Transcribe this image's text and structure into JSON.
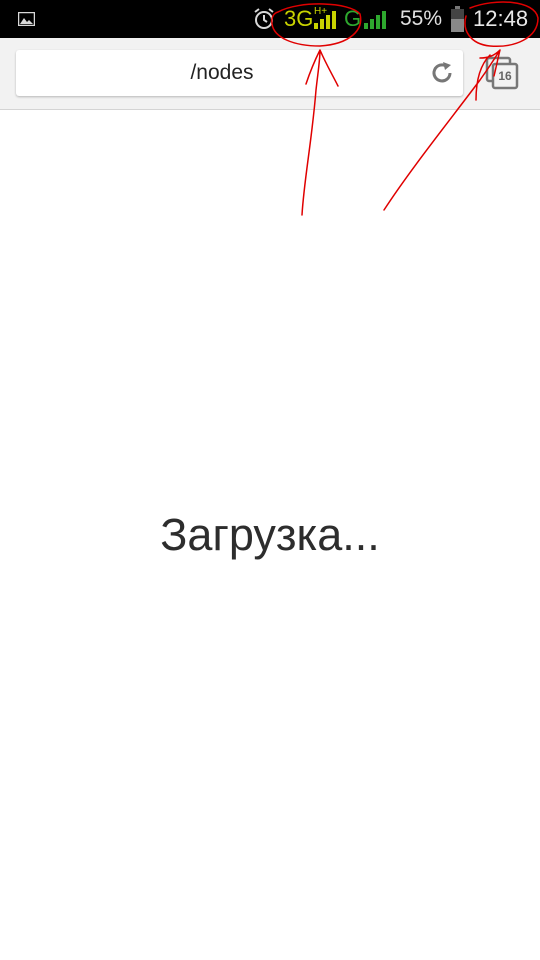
{
  "status_bar": {
    "network_type": "3G",
    "network_sub": "H+",
    "second_network": "G",
    "battery_percent": "55%",
    "time": "12:48",
    "icons": [
      "gallery-icon",
      "alarm-icon",
      "signal-icon",
      "battery-icon"
    ],
    "colors": {
      "network": "#c9d300",
      "signal_secondary": "#2ea82e"
    }
  },
  "browser": {
    "url": "/nodes",
    "tab_count": "16",
    "icons": [
      "reload-icon",
      "tabs-icon"
    ]
  },
  "page": {
    "loading_text": "Загрузка..."
  },
  "annotations": {
    "color": "#e00000"
  }
}
